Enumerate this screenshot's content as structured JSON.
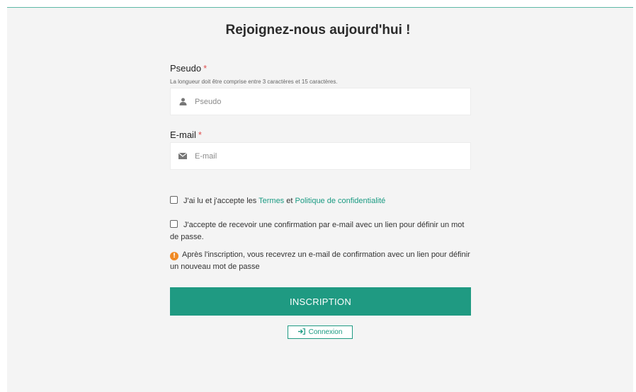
{
  "title": "Rejoignez-nous aujourd'hui !",
  "pseudo": {
    "label": "Pseudo",
    "required_mark": "*",
    "hint": "La longueur doit être comprise entre 3 caractères et 15 caractères.",
    "placeholder": "Pseudo",
    "icon": "user-icon"
  },
  "email": {
    "label": "E-mail",
    "required_mark": "*",
    "placeholder": "E-mail",
    "icon": "envelope-icon"
  },
  "terms": {
    "prefix": "J'ai lu et j'accepte les ",
    "terms_link": "Termes",
    "conjunction": " et ",
    "privacy_link": "Politique de confidentialité",
    "checked": false
  },
  "confirm_email": {
    "text": "J'accepte de recevoir une confirmation par e-mail avec un lien pour définir un mot de passe.",
    "checked": false
  },
  "info": {
    "icon": "info-icon",
    "text": "Après l'inscription, vous recevrez un e-mail de confirmation avec un lien pour définir un nouveau mot de passe"
  },
  "submit_label": "INSCRIPTION",
  "login_label": "Connexion",
  "colors": {
    "accent": "#1f9a82",
    "required": "#e05050",
    "info": "#f08a24",
    "panel_bg": "#f4f4f4"
  }
}
